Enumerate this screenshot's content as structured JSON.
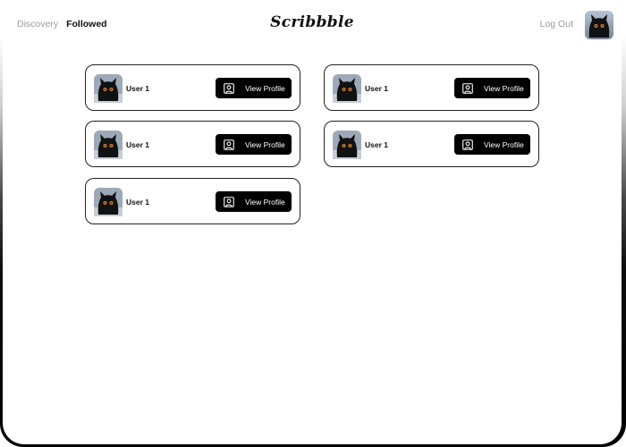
{
  "header": {
    "nav": [
      {
        "label": "Discovery",
        "active": false
      },
      {
        "label": "Followed",
        "active": true
      }
    ],
    "brand": "Scribbble",
    "logout_label": "Log Out",
    "avatar_icon": "black-cat-avatar"
  },
  "users": [
    {
      "name": "User 1",
      "button_label": "View Profile",
      "avatar_icon": "black-cat-avatar",
      "button_icon": "profile-icon"
    },
    {
      "name": "User 1",
      "button_label": "View Profile",
      "avatar_icon": "black-cat-avatar",
      "button_icon": "profile-icon"
    },
    {
      "name": "User 1",
      "button_label": "View Profile",
      "avatar_icon": "black-cat-avatar",
      "button_icon": "profile-icon"
    },
    {
      "name": "User 1",
      "button_label": "View Profile",
      "avatar_icon": "black-cat-avatar",
      "button_icon": "profile-icon"
    },
    {
      "name": "User 1",
      "button_label": "View Profile",
      "avatar_icon": "black-cat-avatar",
      "button_icon": "profile-icon"
    }
  ],
  "colors": {
    "button_bg": "#000000",
    "muted_text": "#9b9b9b",
    "primary_text": "#111111"
  }
}
